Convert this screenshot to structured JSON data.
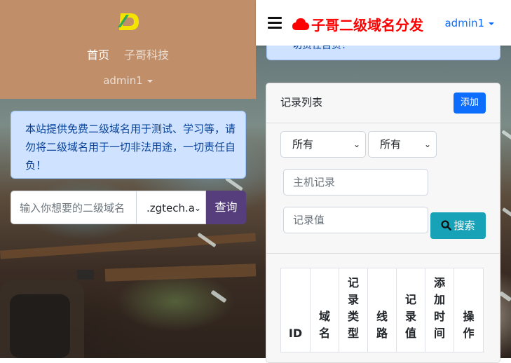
{
  "left": {
    "nav": {
      "home": "首页",
      "brand": "子哥科技"
    },
    "user": "admin1",
    "notice": "本站提供免费二级域名用于测试、学习等，请勿将二级域名用于一切非法用途，一切责任自负！",
    "search": {
      "placeholder": "输入你想要的二级域名",
      "suffix": ".zgtech.a",
      "button": "查询"
    }
  },
  "right": {
    "brand": "子哥二级域名分发",
    "user": "admin1",
    "notice_tail": "切责任自负！",
    "card": {
      "title": "记录列表",
      "add_button": "添加",
      "filter1": "所有",
      "filter2": "所有",
      "host_placeholder": "主机记录",
      "value_placeholder": "记录值",
      "search_button": "搜索",
      "columns": [
        "ID",
        "域名",
        "记录类型",
        "线路",
        "记录值",
        "添加时间",
        "操作"
      ]
    }
  },
  "colors": {
    "header_bg": "#c08f6a",
    "alert_bg": "#cfe2ff",
    "query_btn": "#563d7c",
    "primary": "#0d6efd",
    "info": "#17a2b8",
    "brand_red": "#ff0000"
  },
  "icons": [
    "logo-icon",
    "hamburger-icon",
    "cloud-icon",
    "search-icon",
    "caret-down-icon"
  ]
}
